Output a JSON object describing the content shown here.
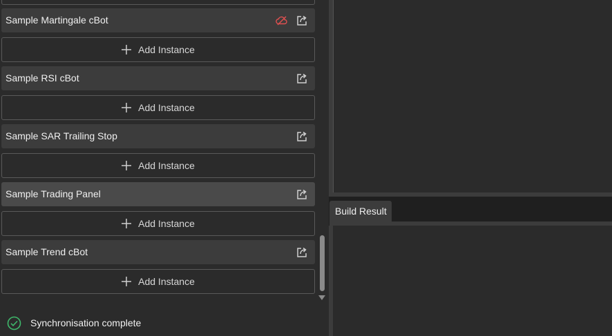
{
  "bots": [
    {
      "name": "Sample Martingale cBot",
      "has_cloud_off": true,
      "active": false
    },
    {
      "name": "Sample RSI cBot",
      "has_cloud_off": false,
      "active": false
    },
    {
      "name": "Sample SAR Trailing Stop",
      "has_cloud_off": false,
      "active": false
    },
    {
      "name": "Sample Trading Panel",
      "has_cloud_off": false,
      "active": true
    },
    {
      "name": "Sample Trend cBot",
      "has_cloud_off": false,
      "active": false
    }
  ],
  "add_instance_label": "Add Instance",
  "status": {
    "text": "Synchronisation complete",
    "icon": "check-circle-icon",
    "color": "#3fb86b"
  },
  "build_result": {
    "tab_label": "Build Result"
  },
  "colors": {
    "background": "#2b2b2b",
    "row": "#3c3c3c",
    "row_active": "#4a4a4a",
    "cloud_off": "#e05050"
  }
}
